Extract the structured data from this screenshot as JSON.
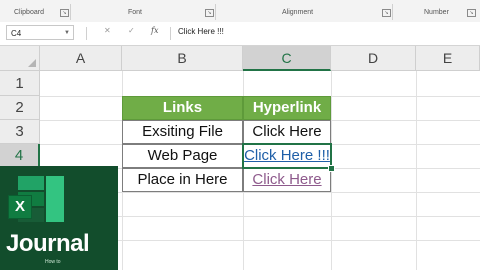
{
  "ribbon": {
    "groups": [
      {
        "label": "Clipboard"
      },
      {
        "label": "Font"
      },
      {
        "label": "Alignment"
      },
      {
        "label": "Number"
      }
    ]
  },
  "formula_bar": {
    "name_box": "C4",
    "cancel_icon": "✕",
    "enter_icon": "✓",
    "fx_label": "fx",
    "formula": "Click Here !!!"
  },
  "columns": [
    "A",
    "B",
    "C",
    "D",
    "E"
  ],
  "rows": [
    "1",
    "2",
    "3",
    "4",
    "5"
  ],
  "table": {
    "headers": [
      "Links",
      "Hyperlink"
    ],
    "rows": [
      {
        "label": "Exsiting File",
        "link": "Click Here"
      },
      {
        "label": "Web Page",
        "link": "Click Here !!!"
      },
      {
        "label": "Place in Here",
        "link": "Click Here"
      }
    ]
  },
  "brand": {
    "name": "Journal",
    "subtitle": "How to",
    "logo_letter": "X",
    "colors": {
      "excel_green": "#217346",
      "table_header": "#70ad47",
      "link_blue": "#1f5fa8",
      "visited": "#8e5a8c"
    }
  }
}
